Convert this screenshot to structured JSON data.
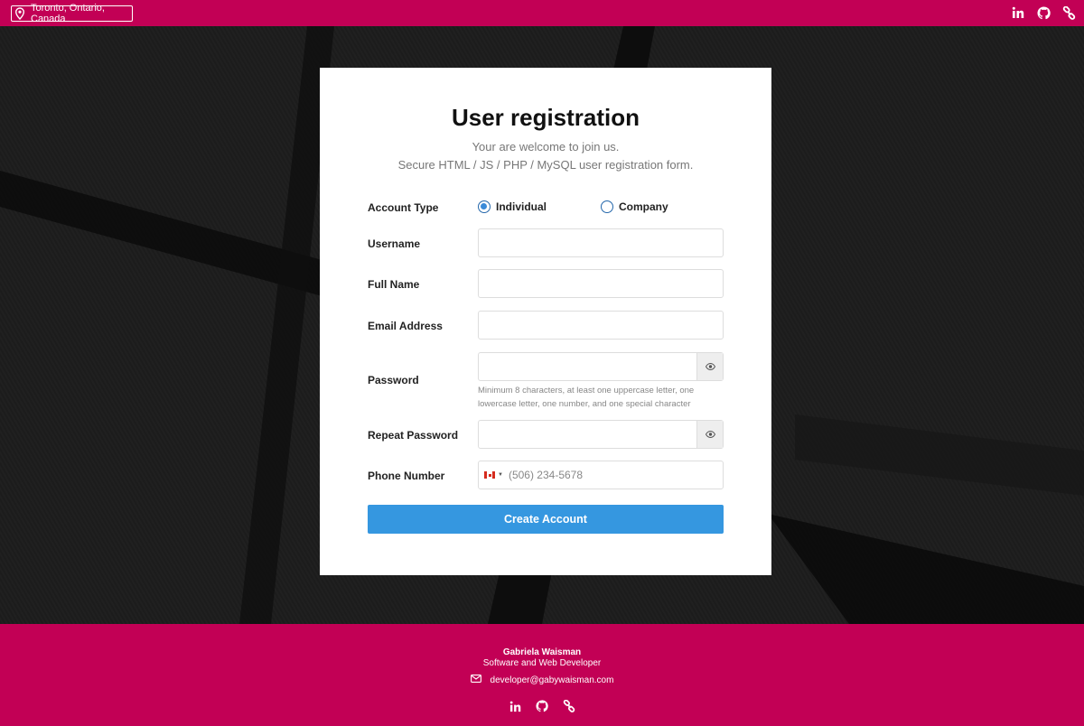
{
  "topbar": {
    "location": "Toronto, Ontario, Canada",
    "icons": [
      "linkedin-icon",
      "github-icon",
      "link-icon"
    ]
  },
  "colors": {
    "brand": "#c20055",
    "accent": "#3597e0",
    "background": "#181818"
  },
  "form": {
    "title": "User registration",
    "subtitle_line1": "Your are welcome to join us.",
    "subtitle_line2": "Secure HTML / JS / PHP / MySQL user registration form.",
    "account_type_label": "Account Type",
    "account_types": [
      {
        "label": "Individual",
        "selected": true
      },
      {
        "label": "Company",
        "selected": false
      }
    ],
    "username_label": "Username",
    "username_value": "",
    "fullname_label": "Full Name",
    "fullname_value": "",
    "email_label": "Email Address",
    "email_value": "",
    "password_label": "Password",
    "password_value": "",
    "password_hint_line1": "Minimum 8 characters, at least one uppercase letter, one",
    "password_hint_line2": "lowercase letter, one number, and one special character",
    "repeat_password_label": "Repeat Password",
    "repeat_password_value": "",
    "phone_label": "Phone Number",
    "phone_country": "CA",
    "phone_placeholder": "(506) 234-5678",
    "submit_label": "Create Account"
  },
  "footer": {
    "name": "Gabriela Waisman",
    "role": "Software and Web Developer",
    "email": "developer@gabywaisman.com",
    "icons": [
      "linkedin-icon",
      "github-icon",
      "link-icon"
    ]
  }
}
